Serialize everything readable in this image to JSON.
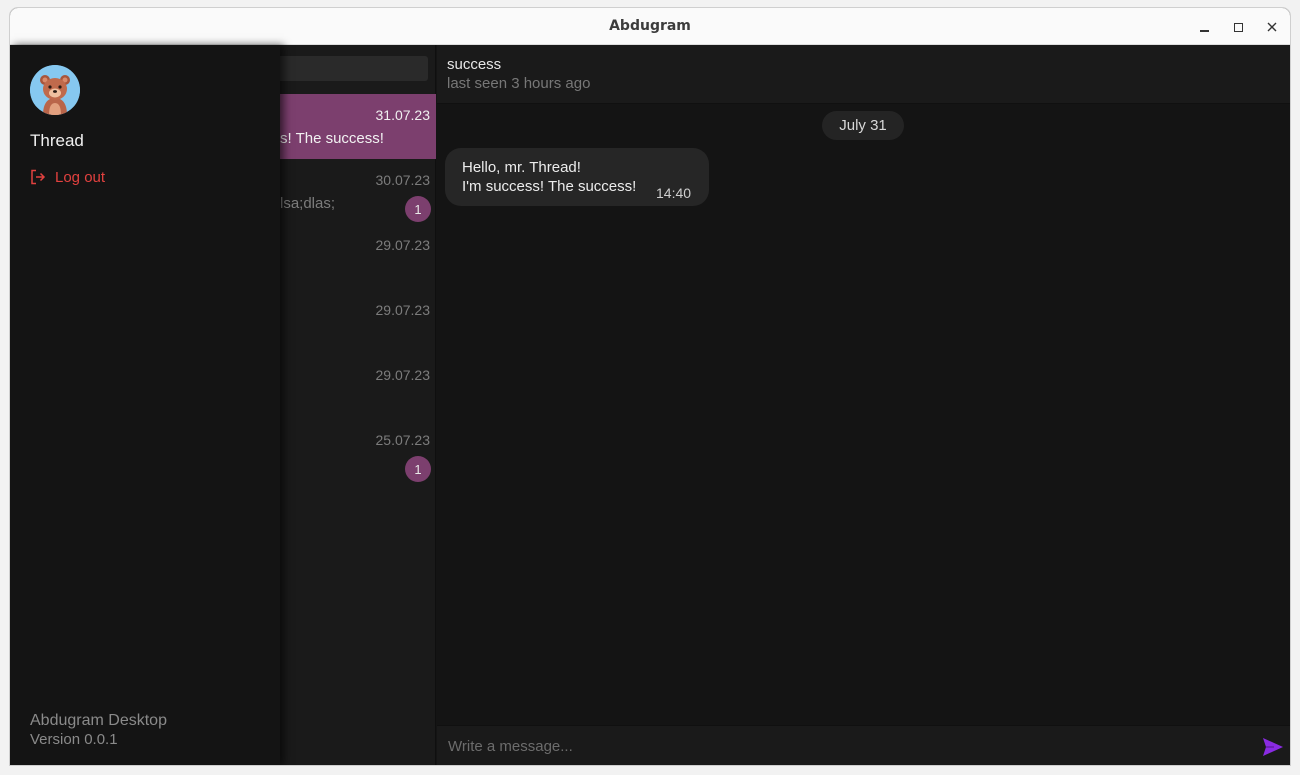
{
  "window": {
    "title": "Abdugram"
  },
  "drawer": {
    "username": "Thread",
    "logout_label": "Log out",
    "app_name": "Abdugram Desktop",
    "version": "Version 0.0.1"
  },
  "chatlist": {
    "items": [
      {
        "date": "31.07.23",
        "preview": "s! The success!",
        "badge": "",
        "active": true
      },
      {
        "date": "30.07.23",
        "preview": "lsa;dlas;",
        "badge": "1",
        "active": false
      },
      {
        "date": "29.07.23",
        "preview": "",
        "badge": "",
        "active": false
      },
      {
        "date": "29.07.23",
        "preview": "",
        "badge": "",
        "active": false
      },
      {
        "date": "29.07.23",
        "preview": "",
        "badge": "",
        "active": false
      },
      {
        "date": "25.07.23",
        "preview": "",
        "badge": "1",
        "active": false
      }
    ]
  },
  "conversation": {
    "peer_name": "success",
    "peer_status": "last seen 3 hours ago",
    "date_divider": "July 31",
    "messages": [
      {
        "line1": "Hello, mr. Thread!",
        "line2": "I'm success! The success!",
        "time": "14:40"
      }
    ],
    "composer_placeholder": "Write a message..."
  },
  "colors": {
    "accent": "#7c3f6e",
    "logout": "#e2413f",
    "send": "#8a2be2"
  }
}
